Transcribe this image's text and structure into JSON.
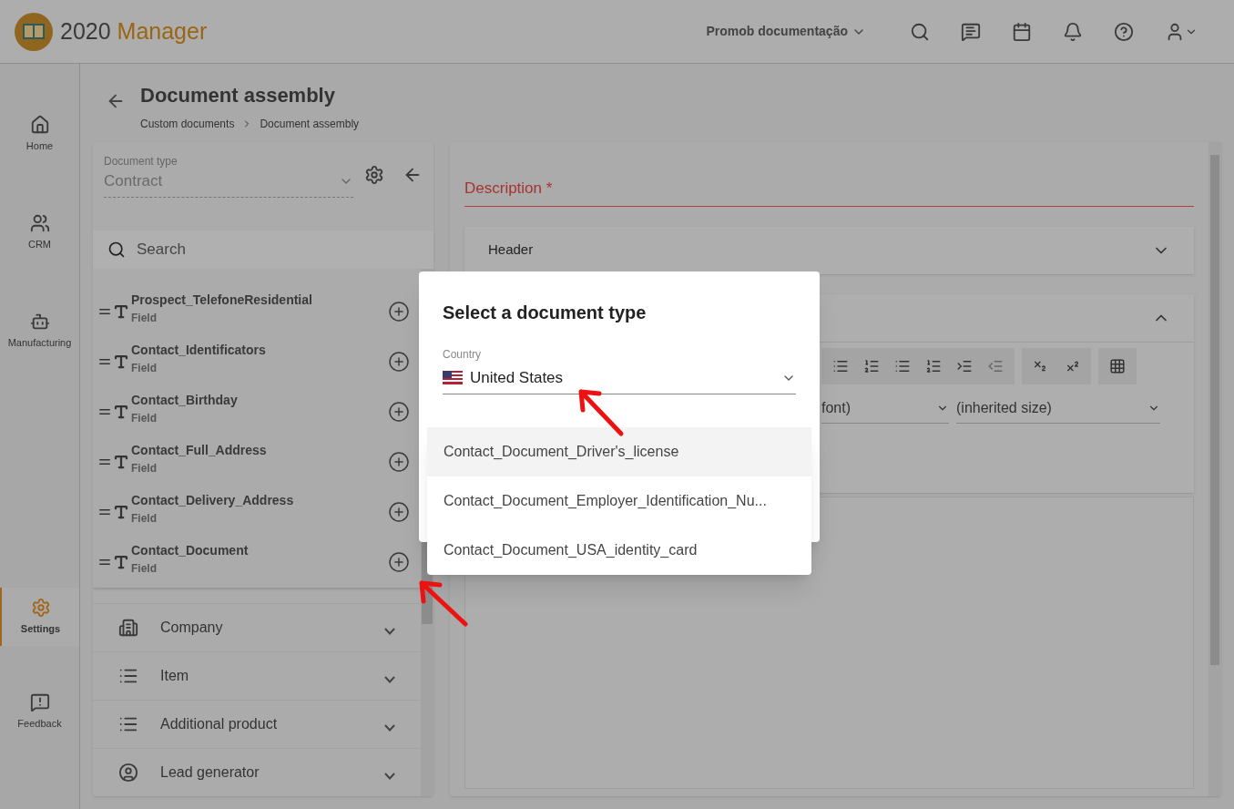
{
  "header": {
    "brand_number": "2020",
    "brand_name": "Manager",
    "workspace": "Promob documentação"
  },
  "nav": [
    {
      "label": "Home",
      "selected": false
    },
    {
      "label": "CRM",
      "selected": false
    },
    {
      "label": "Manufacturing",
      "selected": false
    },
    {
      "label": "Settings",
      "selected": true
    },
    {
      "label": "Feedback",
      "selected": false
    }
  ],
  "page": {
    "title": "Document assembly",
    "breadcrumb": [
      "Custom documents",
      "Document assembly"
    ]
  },
  "left_panel": {
    "document_type_label": "Document type",
    "document_type": "Contract",
    "search_placeholder": "Search",
    "fields": [
      {
        "name": "Prospect_TelefoneResidential",
        "kind": "Field"
      },
      {
        "name": "Contact_Identificators",
        "kind": "Field"
      },
      {
        "name": "Contact_Birthday",
        "kind": "Field"
      },
      {
        "name": "Contact_Full_Address",
        "kind": "Field"
      },
      {
        "name": "Contact_Delivery_Address",
        "kind": "Field"
      },
      {
        "name": "Contact_Document",
        "kind": "Field"
      }
    ],
    "categories": [
      {
        "label": "Company"
      },
      {
        "label": "Item"
      },
      {
        "label": "Additional product"
      },
      {
        "label": "Lead generator"
      }
    ]
  },
  "right_panel": {
    "description_label": "Description *",
    "sections": [
      {
        "label": "Header",
        "expanded": false
      },
      {
        "expanded": true
      }
    ],
    "font_select": "font)",
    "size_select": "(inherited size)"
  },
  "dialog": {
    "title": "Select a document type",
    "country_label": "Country",
    "country": "United States",
    "options": [
      {
        "label": "Contact_Document_Driver's_license",
        "selected": true
      },
      {
        "label": "Contact_Document_Employer_Identification_Nu...",
        "selected": false
      },
      {
        "label": "Contact_Document_USA_identity_card",
        "selected": false
      }
    ]
  }
}
